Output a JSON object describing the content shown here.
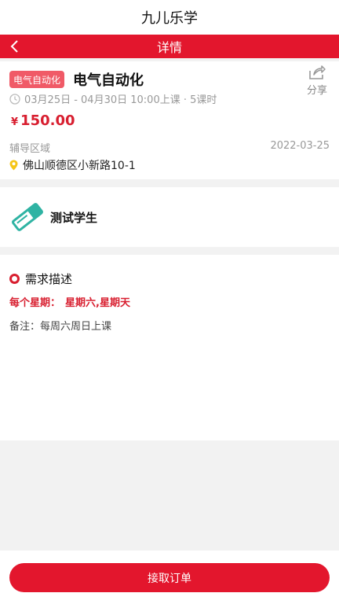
{
  "app": {
    "title": "九儿乐学"
  },
  "nav": {
    "title": "详情",
    "back_icon": "chevron-left-icon"
  },
  "course": {
    "tag": "电气自动化",
    "title": "电气自动化",
    "share_label": "分享",
    "schedule": "03月25日 - 04月30日 10:00上课 · 5课时",
    "currency": "¥",
    "price": "150.00",
    "area_label": "辅导区域",
    "date": "2022-03-25",
    "address": "佛山顺德区小新路10-1"
  },
  "student": {
    "name": "测试学生",
    "icon": "eraser-icon"
  },
  "requirement": {
    "header": "需求描述",
    "week_label": "每个星期：",
    "week_value": "星期六,星期天",
    "note": "备注：每周六周日上课"
  },
  "footer": {
    "accept_label": "接取订单"
  },
  "colors": {
    "accent": "#e3162d",
    "tag_bg": "#f05a67",
    "price": "#d81e2f",
    "pin": "#f5c518",
    "icon_teal": "#2fb3a3"
  }
}
